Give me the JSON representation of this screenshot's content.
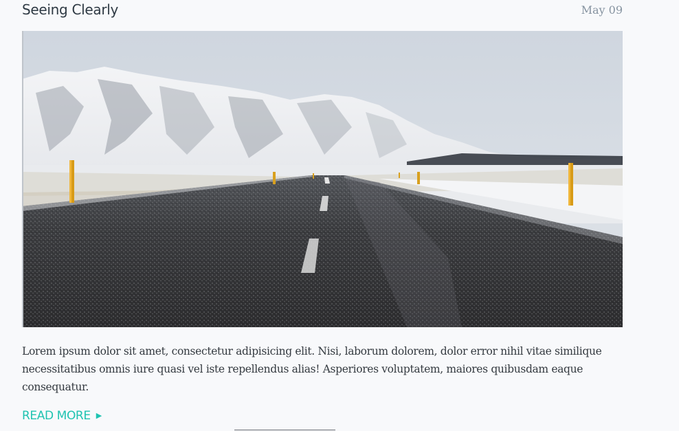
{
  "post": {
    "title": "Seeing Clearly",
    "date": "May 09",
    "excerpt": "Lorem ipsum dolor sit amet, consectetur adipisicing elit. Nisi, laborum dolorem, dolor error nihil vitae similique necessitatibus omnis iure quasi vel iste repellendus alias! Asperiores voluptatem, maiores quibusdam eaque consequatur.",
    "read_more_label": "READ MORE",
    "read_more_icon": "play-arrow-icon",
    "image_subject": "snowy mountain road"
  },
  "colors": {
    "accent": "#1fc3b1",
    "title": "#2f3a44",
    "date": "#8693a0",
    "body_text": "#343a40",
    "background": "#f8f9fb"
  }
}
